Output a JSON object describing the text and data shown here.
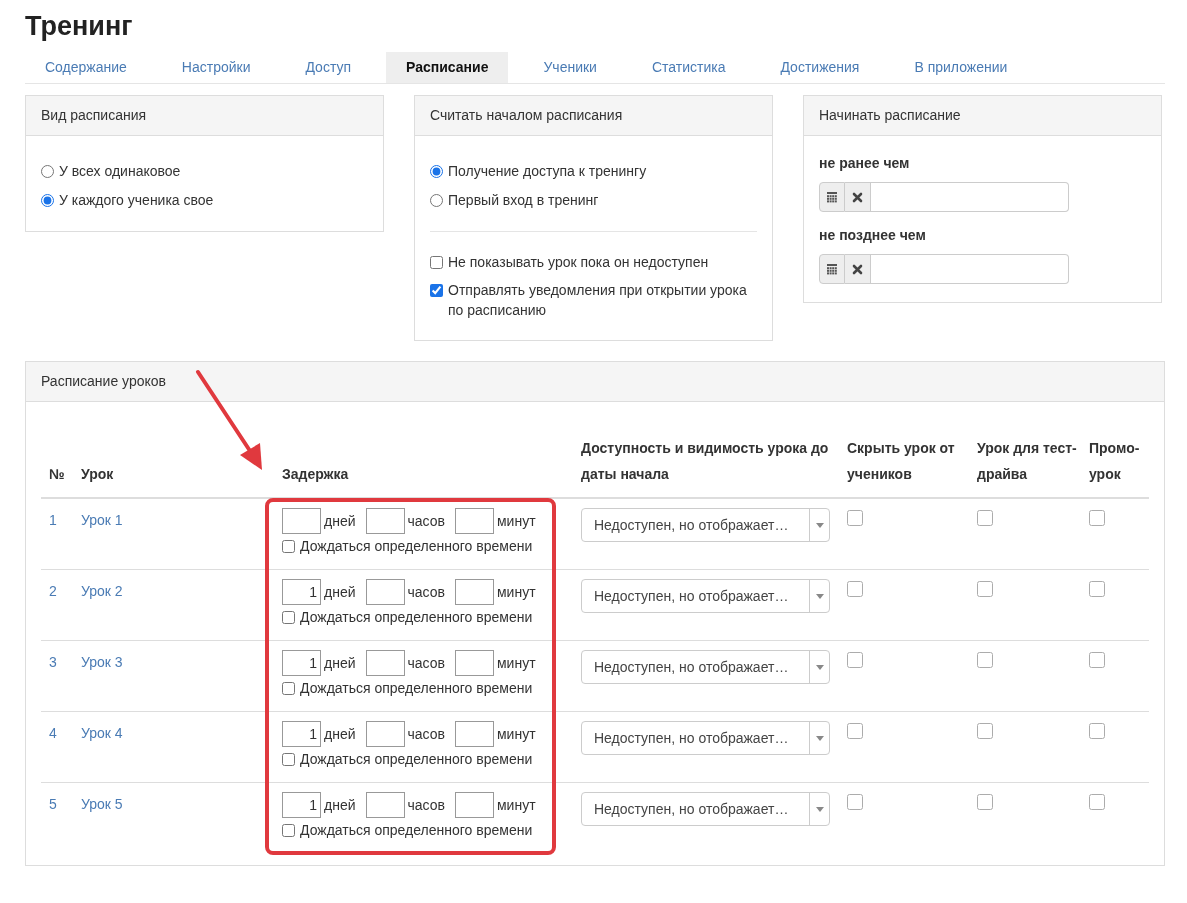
{
  "title": "Тренинг",
  "tabs": [
    {
      "label": "Содержание",
      "selected": false
    },
    {
      "label": "Настройки",
      "selected": false
    },
    {
      "label": "Доступ",
      "selected": false
    },
    {
      "label": "Расписание",
      "selected": true
    },
    {
      "label": "Ученики",
      "selected": false
    },
    {
      "label": "Статистика",
      "selected": false
    },
    {
      "label": "Достижения",
      "selected": false
    },
    {
      "label": "В приложении",
      "selected": false
    }
  ],
  "schedule_type": {
    "title": "Вид расписания",
    "options": [
      {
        "label": "У всех одинаковое",
        "selected": false
      },
      {
        "label": "У каждого ученика свое",
        "selected": true
      }
    ]
  },
  "schedule_start": {
    "title": "Считать началом расписания",
    "options": [
      {
        "label": "Получение доступа к тренингу",
        "selected": true
      },
      {
        "label": "Первый вход в тренинг",
        "selected": false
      }
    ],
    "checkboxes": [
      {
        "label": "Не показывать урок пока он недоступен",
        "checked": false
      },
      {
        "label": "Отправлять уведомления при открытии урока по расписанию",
        "checked": true
      }
    ]
  },
  "start_window": {
    "title": "Начинать расписание",
    "fields": [
      {
        "label": "не ранее чем"
      },
      {
        "label": "не позднее чем"
      }
    ]
  },
  "lesson_schedule": {
    "title": "Расписание уроков",
    "columns": [
      "№",
      "Урок",
      "Задержка",
      "Доступность и видимость урока до даты начала",
      "Скрыть урок от учеников",
      "Урок для тест-драйва",
      "Промо-урок"
    ],
    "rows": [
      {
        "number": "1",
        "lesson": "Урок 1",
        "delay": [
          {
            "unit": "дней"
          },
          {
            "unit": "часов"
          },
          {
            "unit": "минут"
          }
        ],
        "wait": {
          "label": "Дождаться определенного времени",
          "checked": false
        },
        "visibility": "Недоступен, но отображает…",
        "hidden": false,
        "test_drive": false,
        "promo": false
      },
      {
        "number": "2",
        "lesson": "Урок 2",
        "delay": [
          {
            "value": "1",
            "unit": "дней"
          },
          {
            "unit": "часов"
          },
          {
            "unit": "минут"
          }
        ],
        "wait": {
          "label": "Дождаться определенного времени",
          "checked": false
        },
        "visibility": "Недоступен, но отображает…",
        "hidden": false,
        "test_drive": false,
        "promo": false
      },
      {
        "number": "3",
        "lesson": "Урок 3",
        "delay": [
          {
            "value": "1",
            "unit": "дней"
          },
          {
            "unit": "часов"
          },
          {
            "unit": "минут"
          }
        ],
        "wait": {
          "label": "Дождаться определенного времени",
          "checked": false
        },
        "visibility": "Недоступен, но отображает…",
        "hidden": false,
        "test_drive": false,
        "promo": false
      },
      {
        "number": "4",
        "lesson": "Урок 4",
        "delay": [
          {
            "value": "1",
            "unit": "дней"
          },
          {
            "unit": "часов"
          },
          {
            "unit": "минут"
          }
        ],
        "wait": {
          "label": "Дождаться определенного времени",
          "checked": false
        },
        "visibility": "Недоступен, но отображает…",
        "hidden": false,
        "test_drive": false,
        "promo": false
      },
      {
        "number": "5",
        "lesson": "Урок 5",
        "delay": [
          {
            "value": "1",
            "unit": "дней"
          },
          {
            "unit": "часов"
          },
          {
            "unit": "минут"
          }
        ],
        "wait": {
          "label": "Дождаться определенного времени",
          "checked": false
        },
        "visibility": "Недоступен, но отображает…",
        "hidden": false,
        "test_drive": false,
        "promo": false
      }
    ]
  }
}
